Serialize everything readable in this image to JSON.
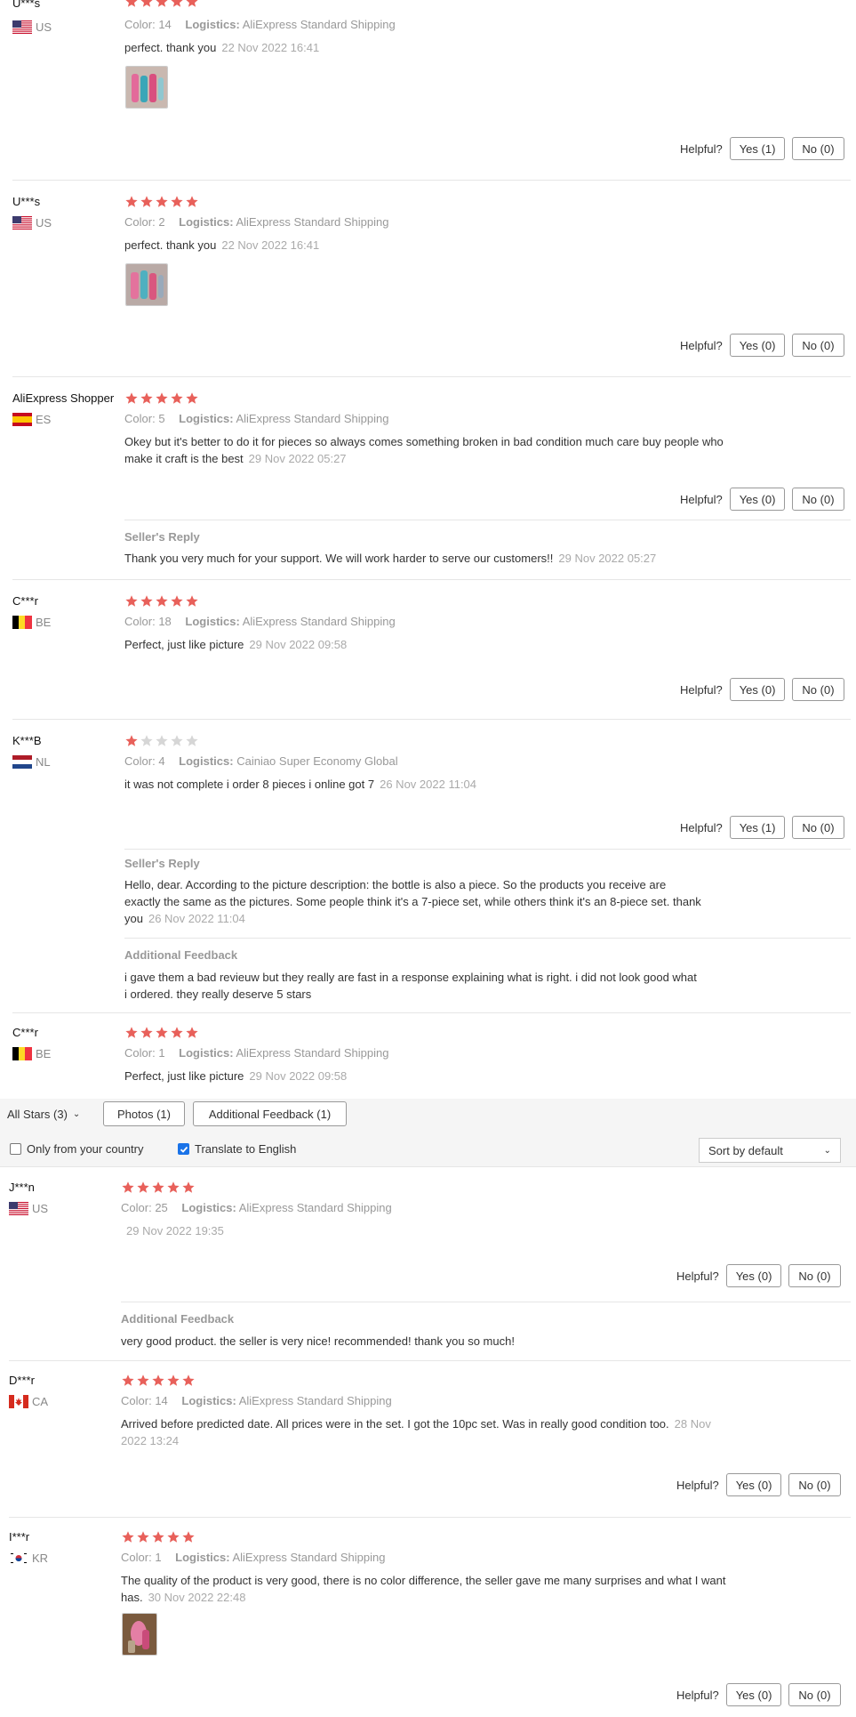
{
  "colors": {
    "star_on": "#e8605a",
    "star_off": "#d6d6d6",
    "accent": "#1a73e8"
  },
  "common": {
    "color_label": "Color:",
    "logistics_label": "Logistics:",
    "helpful_label": "Helpful?",
    "sellers_reply_label": "Seller's Reply",
    "additional_feedback_label": "Additional Feedback"
  },
  "reviews": [
    {
      "user": "U***s",
      "country": "US",
      "flag": "us",
      "stars": 5,
      "color": "14",
      "logistics": "AliExpress Standard Shipping",
      "text": "perfect. thank you",
      "date": "22 Nov 2022 16:41",
      "yes": "Yes (1)",
      "no": "No (0)"
    },
    {
      "user": "U***s",
      "country": "US",
      "flag": "us",
      "stars": 5,
      "color": "2",
      "logistics": "AliExpress Standard Shipping",
      "text": "perfect. thank you",
      "date": "22 Nov 2022 16:41",
      "yes": "Yes (0)",
      "no": "No (0)"
    },
    {
      "user": "AliExpress Shopper",
      "country": "ES",
      "flag": "es",
      "stars": 5,
      "color": "5",
      "logistics": "AliExpress Standard Shipping",
      "text_l1": "Okey but it's better to do it for pieces so always comes something broken in bad condition much care buy people who",
      "text_l2": "make it craft is the best",
      "date": "29 Nov 2022 05:27",
      "yes": "Yes (0)",
      "no": "No (0)",
      "reply": "Thank you very much for your support. We will work harder to serve our customers!!",
      "reply_date": "29 Nov 2022 05:27"
    },
    {
      "user": "C***r",
      "country": "BE",
      "flag": "be",
      "stars": 5,
      "color": "18",
      "logistics": "AliExpress Standard Shipping",
      "text": "Perfect, just like picture",
      "date": "29 Nov 2022 09:58",
      "yes": "Yes (0)",
      "no": "No (0)"
    },
    {
      "user": "K***B",
      "country": "NL",
      "flag": "nl",
      "stars": 1,
      "color": "4",
      "logistics": "Cainiao Super Economy Global",
      "text": "it was not complete i order 8 pieces i online got 7",
      "date": "26 Nov 2022 11:04",
      "yes": "Yes (1)",
      "no": "No (0)",
      "reply_l1": "Hello, dear. According to the picture description: the bottle is also a piece. So the products you receive are",
      "reply_l2": "exactly the same as the pictures. Some people think it's a 7-piece set, while others think it's an 8-piece set. thank",
      "reply_l3": "you",
      "reply_date": "26 Nov 2022 11:04",
      "additional_l1": "i gave them a bad revieuw but they really are fast in a response explaining what is right. i did not look good what",
      "additional_l2": "i ordered. they really deserve 5 stars"
    },
    {
      "user": "C***r",
      "country": "BE",
      "flag": "be",
      "stars": 5,
      "color": "1",
      "logistics": "AliExpress Standard Shipping",
      "text": "Perfect, just like picture",
      "date": "29 Nov 2022 09:58"
    },
    {
      "user": "J***n",
      "country": "US",
      "flag": "us",
      "stars": 5,
      "color": "25",
      "logistics": "AliExpress Standard Shipping",
      "date": "29 Nov 2022 19:35",
      "yes": "Yes (0)",
      "no": "No (0)",
      "additional": "very good product. the seller is very nice! recommended! thank you so much!"
    },
    {
      "user": "D***r",
      "country": "CA",
      "flag": "ca",
      "stars": 5,
      "color": "14",
      "logistics": "AliExpress Standard Shipping",
      "text_l1": "Arrived before predicted date. All prices were in the set. I got the 10pc set. Was in really good condition too.",
      "date_l1": "28 Nov",
      "date_l2": "2022 13:24",
      "yes": "Yes (0)",
      "no": "No (0)"
    },
    {
      "user": "I***r",
      "country": "KR",
      "flag": "kr",
      "stars": 5,
      "color": "1",
      "logistics": "AliExpress Standard Shipping",
      "text_l1": "The quality of the product is very good, there is no color difference, the seller gave me many surprises and what I want",
      "text_l2": "has.",
      "date": "30 Nov 2022 22:48",
      "yes": "Yes (0)",
      "no": "No (0)"
    }
  ],
  "filters": {
    "all_stars": "All Stars (3)",
    "photos": "Photos (1)",
    "additional": "Additional Feedback (1)",
    "only_country": "Only from your country",
    "translate": "Translate to English",
    "sort": "Sort by default"
  }
}
